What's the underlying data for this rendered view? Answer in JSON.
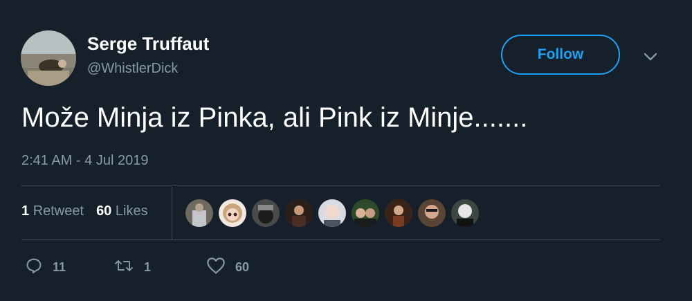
{
  "user": {
    "name": "Serge Truffaut",
    "handle": "@WhistlerDick"
  },
  "follow_label": "Follow",
  "tweet": {
    "text": "Može Minja iz Pinka, ali Pink iz Minje.......",
    "timestamp": "2:41 AM - 4 Jul 2019"
  },
  "stats": {
    "retweets_count": "1",
    "retweets_label": "Retweet",
    "likes_count": "60",
    "likes_label": "Likes"
  },
  "actions": {
    "reply_count": "11",
    "retweet_count": "1",
    "like_count": "60"
  },
  "icons": {
    "more": "chevron-down-icon",
    "reply": "reply-icon",
    "retweet": "retweet-icon",
    "like": "heart-icon"
  },
  "colors": {
    "accent": "#1da1f2",
    "background": "#15202b",
    "muted": "#8899a6",
    "border": "#38444d"
  }
}
